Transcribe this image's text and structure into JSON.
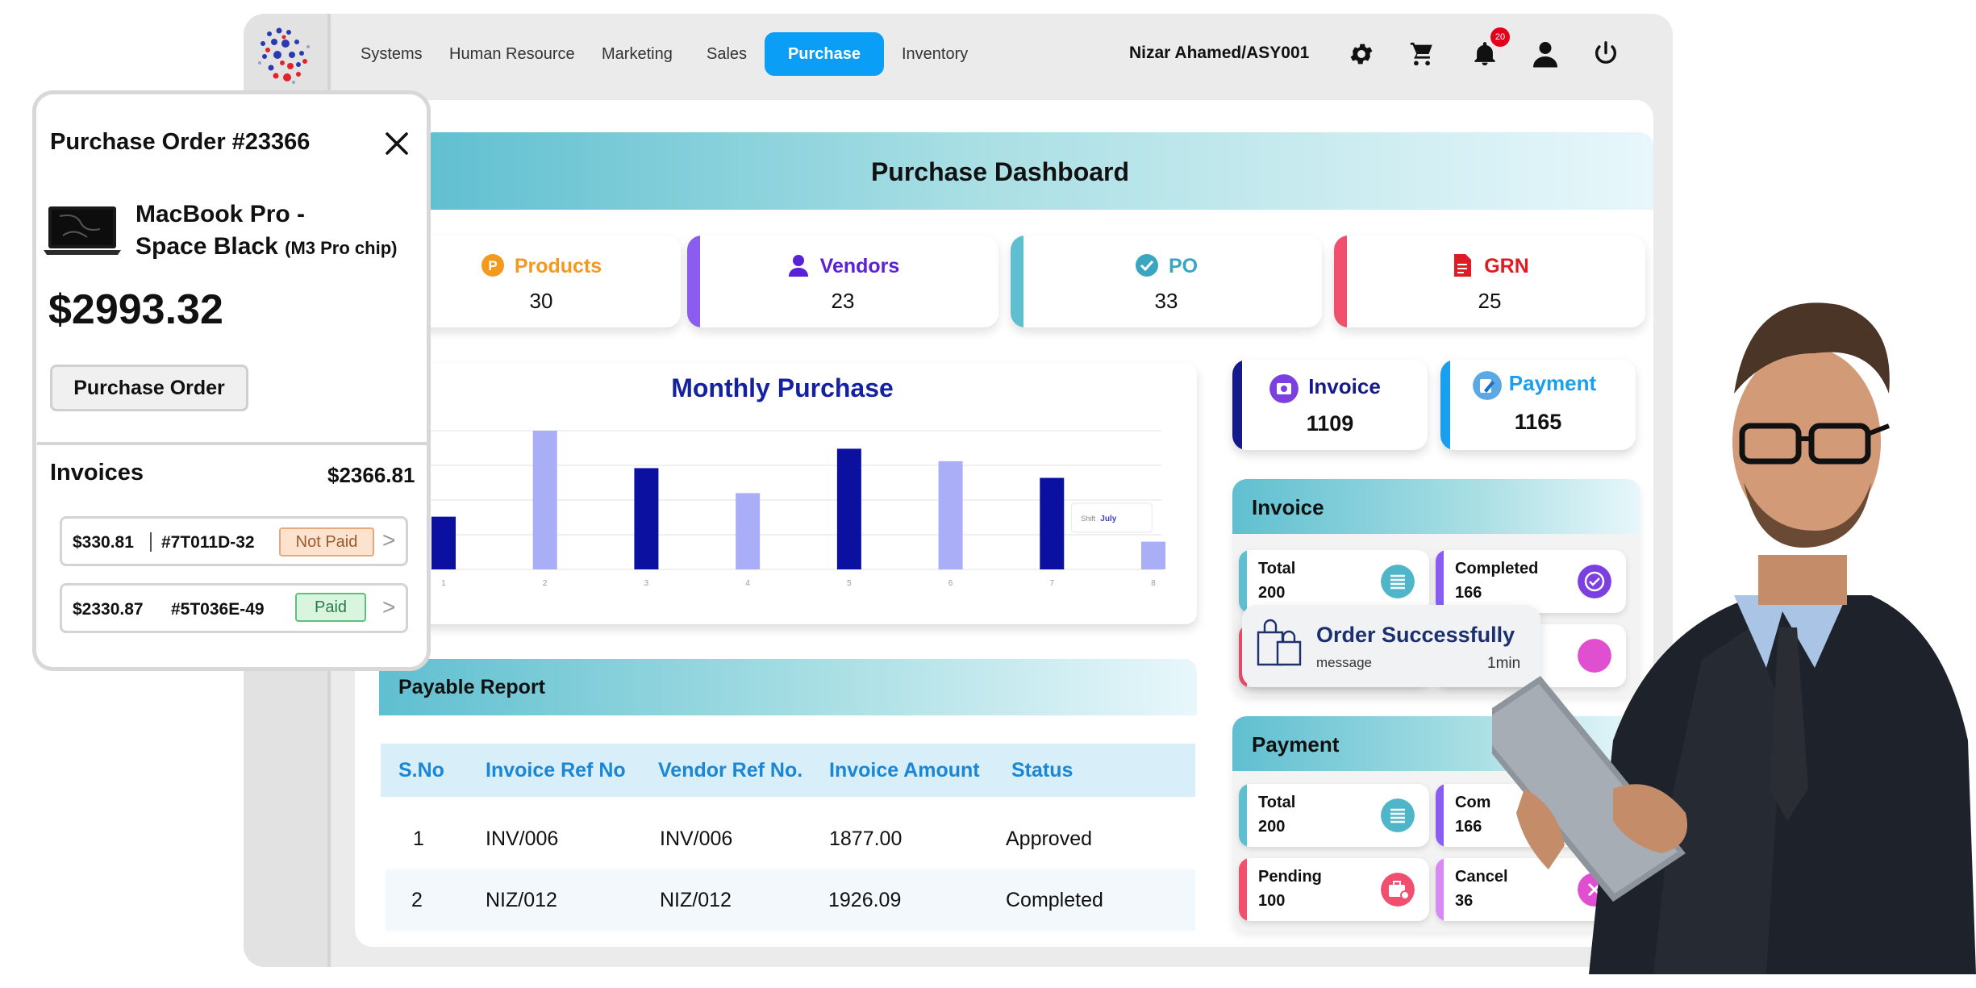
{
  "nav": {
    "items": [
      "Systems",
      "Human Resource",
      "Marketing",
      "Sales",
      "Purchase",
      "Inventory"
    ],
    "active": "Purchase",
    "user": "Nizar Ahamed/ASY001",
    "notification_count": "20"
  },
  "dashboard": {
    "title": "Purchase Dashboard",
    "stats": [
      {
        "label": "Products",
        "value": "30",
        "color": "#f39a1e",
        "icon": "p-circle-icon"
      },
      {
        "label": "Vendors",
        "value": "23",
        "color": "#5b21d6",
        "icon": "person-icon"
      },
      {
        "label": "PO",
        "value": "33",
        "color": "#3aa6c0",
        "icon": "check-circle-icon"
      },
      {
        "label": "GRN",
        "value": "25",
        "color": "#e01b24",
        "icon": "document-icon"
      }
    ],
    "mini": [
      {
        "label": "Invoice",
        "value": "1109",
        "color": "#141a8a",
        "icon": "camera-icon"
      },
      {
        "label": "Payment",
        "value": "1165",
        "color": "#1a9ef0",
        "icon": "payment-icon"
      }
    ]
  },
  "chart_data": {
    "type": "bar",
    "title": "Monthly Purchase",
    "categories": [
      "1",
      "2",
      "3",
      "4",
      "5",
      "6",
      "7",
      "8"
    ],
    "values": [
      38,
      100,
      73,
      55,
      87,
      78,
      66,
      20
    ],
    "bar_colors": [
      "#0c10a0",
      "#a9aef7",
      "#0c10a0",
      "#a9aef7",
      "#0c10a0",
      "#a9aef7",
      "#0c10a0",
      "#a9aef7"
    ],
    "ylim": [
      0,
      100
    ],
    "grid": true,
    "tooltip": {
      "label": "Shift",
      "value": "July"
    }
  },
  "invoice_panel": {
    "title": "Invoice",
    "tiles": [
      {
        "label": "Total",
        "value": "200",
        "color": "#5fbfd0"
      },
      {
        "label": "Completed",
        "value": "166",
        "color": "#8a5cf0"
      }
    ]
  },
  "payment_panel": {
    "title": "Payment",
    "tiles": [
      {
        "label": "Total",
        "value": "200",
        "color": "#5fbfd0"
      },
      {
        "label": "Com",
        "value": "166",
        "color": "#8a5cf0"
      },
      {
        "label": "Pending",
        "value": "100",
        "color": "#f0506e"
      },
      {
        "label": "Cancel",
        "value": "36",
        "color": "#d98af0"
      }
    ]
  },
  "toast": {
    "title": "Order Successfully",
    "message": "message",
    "time": "1min"
  },
  "report": {
    "title": "Payable Report",
    "columns": [
      "S.No",
      "Invoice Ref No",
      "Vendor Ref No.",
      "Invoice Amount",
      "Status"
    ],
    "rows": [
      [
        "1",
        "INV/006",
        "INV/006",
        "1877.00",
        "Approved"
      ],
      [
        "2",
        "NIZ/012",
        "NIZ/012",
        "1926.09",
        "Completed"
      ]
    ]
  },
  "purchase_order": {
    "title": "Purchase Order #23366",
    "product_line1": "MacBook Pro -",
    "product_line2": "Space Black",
    "product_chip": "(M3 Pro chip)",
    "price": "$2993.32",
    "button": "Purchase Order",
    "invoices_label": "Invoices",
    "invoices_total": "$2366.81",
    "invoices": [
      {
        "amount": "$330.81",
        "ref": "#7T011D-32",
        "status": "Not Paid"
      },
      {
        "amount": "$2330.87",
        "ref": "#5T036E-49",
        "status": "Paid"
      }
    ]
  }
}
